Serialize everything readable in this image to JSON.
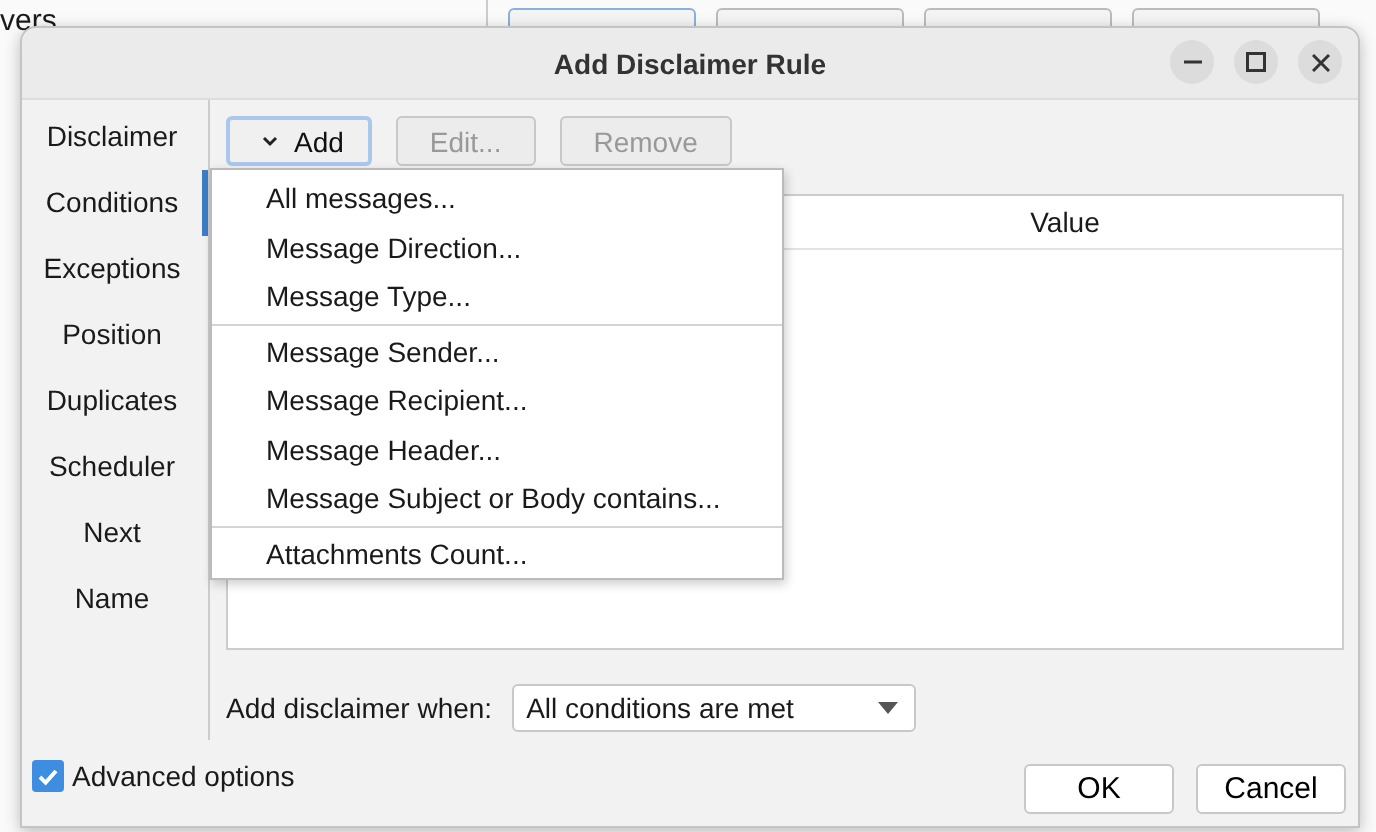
{
  "background": {
    "text": "vers"
  },
  "window": {
    "title": "Add Disclaimer Rule"
  },
  "sidebar": {
    "items": [
      {
        "label": "Disclaimer",
        "selected": false
      },
      {
        "label": "Conditions",
        "selected": true
      },
      {
        "label": "Exceptions",
        "selected": false
      },
      {
        "label": "Position",
        "selected": false
      },
      {
        "label": "Duplicates",
        "selected": false
      },
      {
        "label": "Scheduler",
        "selected": false
      },
      {
        "label": "Next",
        "selected": false
      },
      {
        "label": "Name",
        "selected": false
      }
    ]
  },
  "toolbar": [
    {
      "label": "Add",
      "kind": "dropdown",
      "disabled": false
    },
    {
      "label": "Edit...",
      "kind": "plain",
      "disabled": true
    },
    {
      "label": "Remove",
      "kind": "plain",
      "disabled": true
    }
  ],
  "table": {
    "columns": [
      "Value"
    ]
  },
  "menu": {
    "groups": [
      [
        "All messages...",
        "Message Direction...",
        "Message Type..."
      ],
      [
        "Message Sender...",
        "Message Recipient...",
        "Message Header...",
        "Message Subject or Body contains..."
      ],
      [
        "Attachments Count..."
      ]
    ]
  },
  "when": {
    "label": "Add disclaimer when:",
    "value": "All conditions are met"
  },
  "advanced": {
    "label": "Advanced options",
    "checked": true
  },
  "buttons": [
    "OK",
    "Cancel"
  ]
}
